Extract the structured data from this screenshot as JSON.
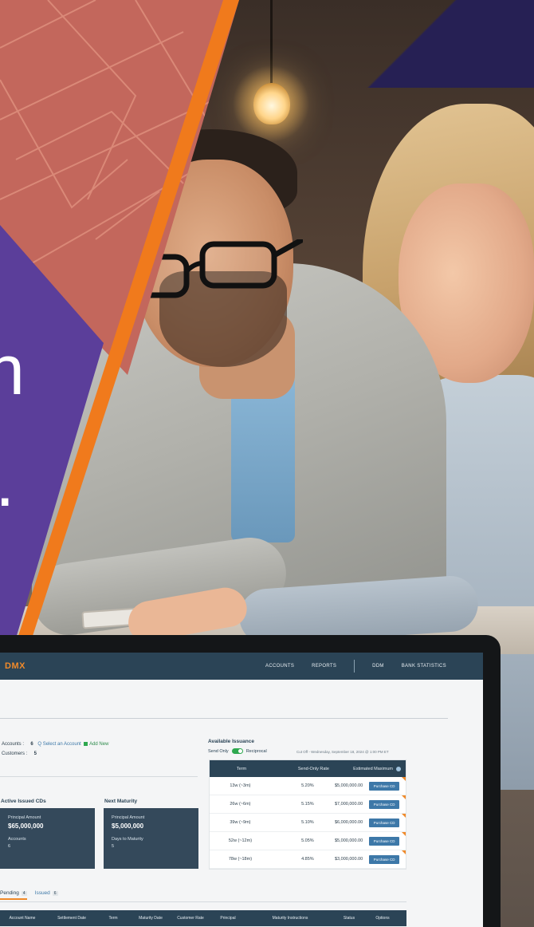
{
  "hero": {
    "glyph_n": "n",
    "glyph_dot": "."
  },
  "app": {
    "logo": "DMX",
    "nav": [
      "ACCOUNTS",
      "REPORTS",
      "DDM",
      "BANK STATISTICS"
    ]
  },
  "accounts": {
    "accounts_label": "Accounts :",
    "accounts_value": "6",
    "customers_label": "Customers :",
    "customers_value": "5",
    "select_link": "Q Select an Account",
    "add_new": "Add New"
  },
  "active_cds": {
    "title": "Active Issued CDs",
    "principal_label": "Principal Amount",
    "principal_value": "$65,000,000",
    "accounts_label": "Accounts",
    "accounts_value": "6"
  },
  "next_maturity": {
    "title": "Next Maturity",
    "principal_label": "Principal Amount",
    "principal_value": "$5,000,000",
    "days_label": "Days to Maturity",
    "days_value": "5"
  },
  "available": {
    "title": "Available Issuance",
    "send_only": "Send Only",
    "reciprocal": "Reciprocal",
    "cutoff": "Cut Off - Wednesday, September 18, 2024 @ 1:00 PM ET",
    "headers": [
      "Term",
      "Send-Only Rate",
      "Estimated Maximum"
    ],
    "rows": [
      {
        "term": "13w (~3m)",
        "rate": "5.20%",
        "max": "$5,000,000.00",
        "action": "Purchase CD"
      },
      {
        "term": "26w (~6m)",
        "rate": "5.15%",
        "max": "$7,000,000.00",
        "action": "Purchase CD"
      },
      {
        "term": "39w (~9m)",
        "rate": "5.10%",
        "max": "$6,000,000.00",
        "action": "Purchase CD"
      },
      {
        "term": "52w (~12m)",
        "rate": "5.05%",
        "max": "$5,000,000.00",
        "action": "Purchase CD"
      },
      {
        "term": "78w (~18m)",
        "rate": "4.85%",
        "max": "$3,000,000.00",
        "action": "Purchase CD"
      }
    ]
  },
  "tabs": {
    "pending": "Pending",
    "pending_count": "4",
    "issued": "Issued",
    "issued_count": "6"
  },
  "cd_table": {
    "headers": [
      "Account Name",
      "Settlement Date",
      "Term",
      "Maturity Date",
      "Customer Rate",
      "Principal",
      "Maturity Instructions",
      "Status",
      "Options"
    ]
  }
}
